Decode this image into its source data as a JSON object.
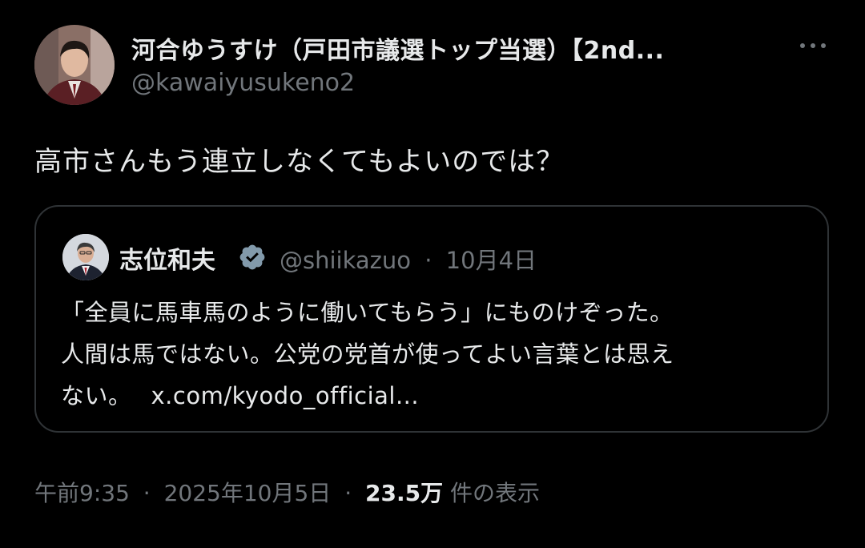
{
  "author": {
    "display_name": "河合ゆうすけ（戸田市議選トップ当選）【2nd...",
    "handle": "@kawaiyusukeno2"
  },
  "post": {
    "text": "高市さんもう連立しなくてもよいのでは？"
  },
  "quote": {
    "name": "志位和夫",
    "handle": "@shiikazuo",
    "separator": "·",
    "date": "10月4日",
    "lines": [
      "「全員に馬車馬のように働いてもらう」にものけぞった。",
      "人間は馬ではない。公党の党首が使ってよい言葉とは思え",
      "ない。"
    ],
    "link": "x.com/kyodo_official..."
  },
  "meta": {
    "time": "午前9:35",
    "sep1": "·",
    "date": "2025年10月5日",
    "sep2": "·",
    "views_count": "23.5万",
    "views_label": "件の表示"
  },
  "icons": {
    "more": "more-horizontal-icon",
    "verified": "verified-badge-icon"
  },
  "colors": {
    "background": "#000000",
    "text_primary": "#e7e9ea",
    "text_secondary": "#71767b",
    "border": "#2f3336",
    "verified": "#829aab"
  }
}
